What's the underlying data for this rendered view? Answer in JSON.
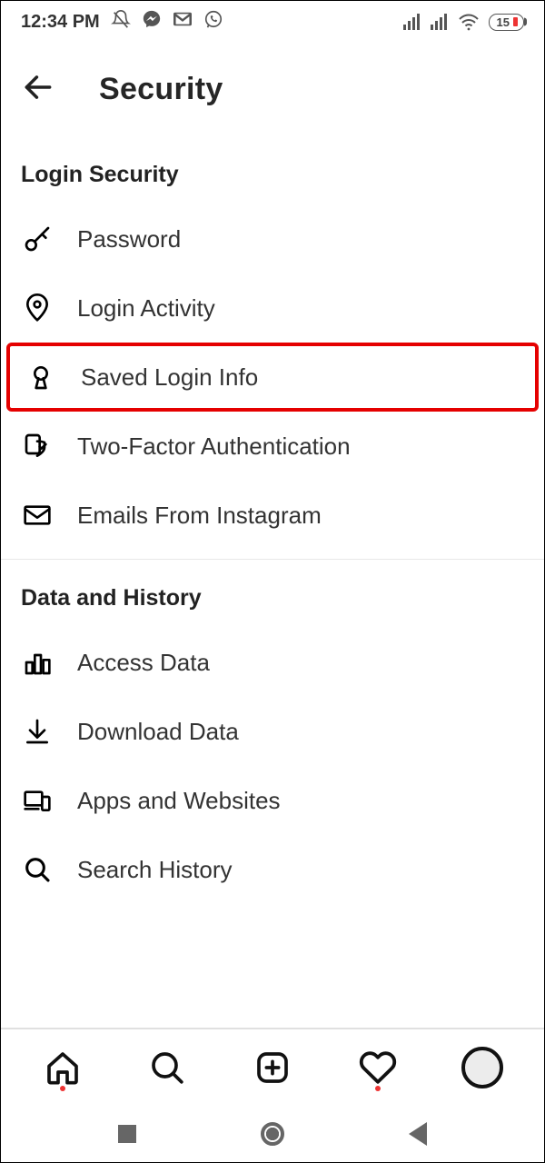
{
  "status": {
    "time": "12:34 PM",
    "battery": "15"
  },
  "header": {
    "title": "Security"
  },
  "sections": {
    "login_security": {
      "title": "Login Security",
      "items": {
        "password": "Password",
        "login_activity": "Login Activity",
        "saved_login_info": "Saved Login Info",
        "two_factor": "Two-Factor Authentication",
        "emails": "Emails From Instagram"
      }
    },
    "data_history": {
      "title": "Data and History",
      "items": {
        "access_data": "Access Data",
        "download_data": "Download Data",
        "apps_websites": "Apps and Websites",
        "search_history": "Search History"
      }
    }
  }
}
